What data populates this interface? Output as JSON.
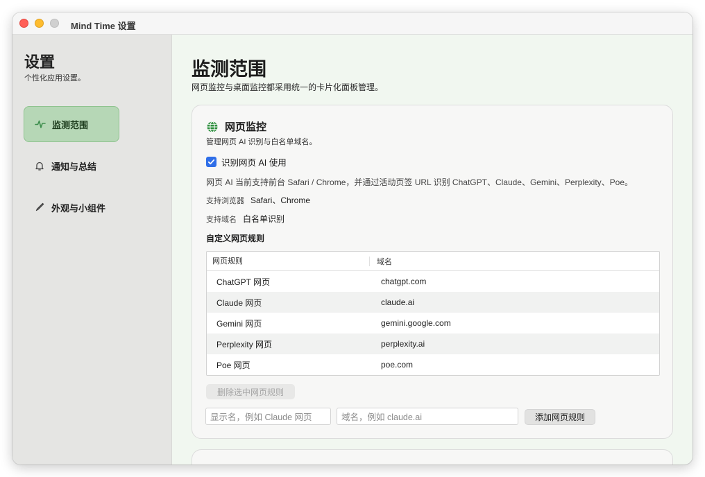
{
  "window": {
    "title": "Mind Time 设置"
  },
  "sidebar": {
    "title": "设置",
    "subtitle": "个性化应用设置。",
    "items": [
      {
        "label": "监测范围",
        "icon": "activity-icon",
        "active": true
      },
      {
        "label": "通知与总结",
        "icon": "bell-icon",
        "active": false
      },
      {
        "label": "外观与小组件",
        "icon": "brush-icon",
        "active": false
      }
    ]
  },
  "main": {
    "title": "监测范围",
    "subtitle": "网页监控与桌面监控都采用统一的卡片化面板管理。",
    "web_card": {
      "icon": "globe-icon",
      "title": "网页监控",
      "desc": "管理网页 AI 识别与白名单域名。",
      "checkbox_label": "识别网页 AI 使用",
      "checkbox_checked": true,
      "info": "网页 AI 当前支持前台 Safari / Chrome，并通过活动页签 URL 识别 ChatGPT、Claude、Gemini、Perplexity、Poe。",
      "browsers_key": "支持浏览器",
      "browsers_value": "Safari、Chrome",
      "domains_key": "支持域名",
      "domains_value": "白名单识别",
      "rules_label": "自定义网页规则",
      "table": {
        "headers": [
          "网页规则",
          "域名"
        ],
        "rows": [
          [
            "ChatGPT 网页",
            "chatgpt.com"
          ],
          [
            "Claude 网页",
            "claude.ai"
          ],
          [
            "Gemini 网页",
            "gemini.google.com"
          ],
          [
            "Perplexity 网页",
            "perplexity.ai"
          ],
          [
            "Poe 网页",
            "poe.com"
          ]
        ]
      },
      "delete_button": "删除选中网页规则",
      "name_placeholder": "显示名，例如 Claude 网页",
      "domain_placeholder": "域名，例如 claude.ai",
      "add_button": "添加网页规则"
    }
  },
  "colors": {
    "accent": "#2f6ee8",
    "sidebar_active": "#b6d7b6",
    "main_bg": "#f1f7f0",
    "traffic_red": "#ff5f57",
    "traffic_yellow": "#febc2e",
    "traffic_gray": "#d0d0d0"
  }
}
